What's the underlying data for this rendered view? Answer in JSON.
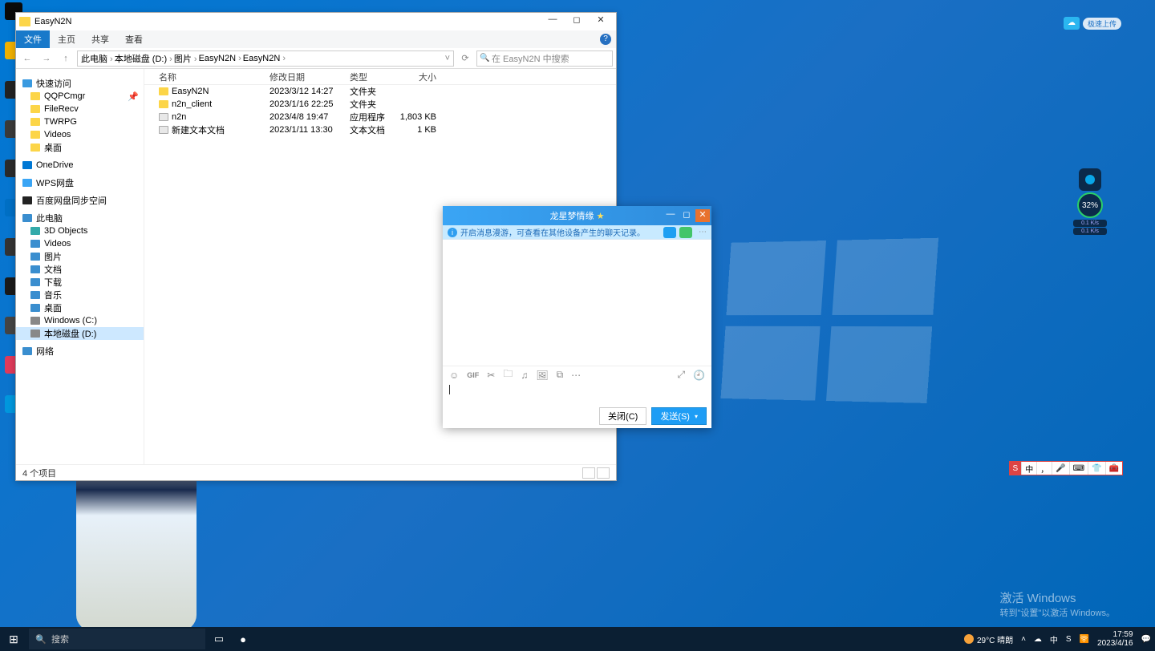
{
  "explorer": {
    "title": "EasyN2N",
    "ribbon": {
      "file": "文件",
      "tabs": [
        "主页",
        "共享",
        "查看"
      ]
    },
    "path_segments": [
      "此电脑",
      "本地磁盘 (D:)",
      "图片",
      "EasyN2N",
      "EasyN2N"
    ],
    "search_placeholder": "在 EasyN2N 中搜索",
    "columns": {
      "name": "名称",
      "date": "修改日期",
      "type": "类型",
      "size": "大小"
    },
    "rows": [
      {
        "name": "EasyN2N",
        "date": "2023/3/12 14:27",
        "type": "文件夹",
        "size": ""
      },
      {
        "name": "n2n_client",
        "date": "2023/1/16 22:25",
        "type": "文件夹",
        "size": ""
      },
      {
        "name": "n2n",
        "date": "2023/4/8 19:47",
        "type": "应用程序",
        "size": "1,803 KB"
      },
      {
        "name": "新建文本文档",
        "date": "2023/1/11 13:30",
        "type": "文本文档",
        "size": "1 KB"
      }
    ],
    "sidebar": {
      "quick": "快速访问",
      "quick_items": [
        "QQPCmgr",
        "FileRecv",
        "TWRPG",
        "Videos",
        "桌面"
      ],
      "onedrive": "OneDrive",
      "wps": "WPS网盘",
      "baidu": "百度网盘同步空间",
      "thispc": "此电脑",
      "pc_items": [
        "3D Objects",
        "Videos",
        "图片",
        "文档",
        "下载",
        "音乐",
        "桌面",
        "Windows (C:)",
        "本地磁盘 (D:)"
      ],
      "network": "网络"
    },
    "status": "4 个项目"
  },
  "chat": {
    "title": "龙星梦情缘",
    "notice": "开启消息漫游，可查看在其他设备产生的聊天记录。",
    "close_btn": "关闭(C)",
    "send_btn": "发送(S)"
  },
  "activation": {
    "l1": "激活 Windows",
    "l2": "转到\"设置\"以激活 Windows。"
  },
  "cloud_badge": "极速上传",
  "gauge": {
    "pct": "32%",
    "up": "0.1 K/s",
    "dn": "0.1 K/s"
  },
  "ime_label": "中",
  "taskbar": {
    "search": "搜索",
    "weather": "29°C 晴朗",
    "lang": "中",
    "time": "17:59",
    "date": "2023/4/16"
  }
}
